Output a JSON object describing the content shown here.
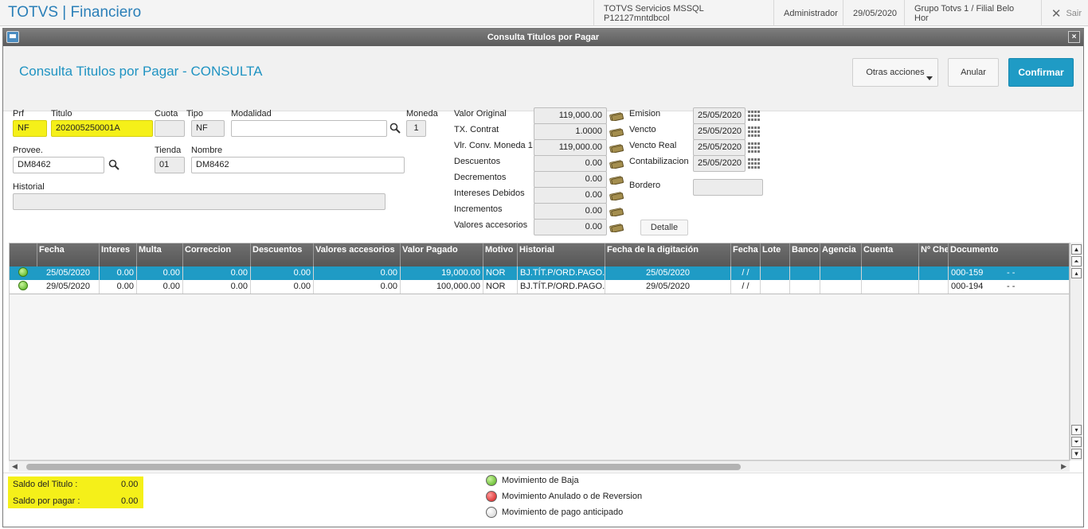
{
  "app": {
    "title": "TOTVS | Financiero",
    "environment": "TOTVS Servicios MSSQL P12127mntdbcol",
    "user": "Administrador",
    "date": "29/05/2020",
    "branch": "Grupo Totvs 1 / Filial Belo Hor",
    "exit_label": "Sair"
  },
  "window": {
    "title": "Consulta Titulos por Pagar",
    "close_label": "×"
  },
  "header": {
    "heading": "Consulta Titulos por Pagar - CONSULTA",
    "other_actions": "Otras acciones",
    "cancel": "Anular",
    "confirm": "Confirmar"
  },
  "form": {
    "prf_label": "Prf",
    "prf": "NF",
    "titulo_label": "Titulo",
    "titulo": "202005250001A",
    "cuota_label": "Cuota",
    "cuota": "",
    "tipo_label": "Tipo",
    "tipo": "NF",
    "modalidad_label": "Modalidad",
    "modalidad": "",
    "moneda_label": "Moneda",
    "moneda": "1",
    "proveedor_label": "Provee.",
    "proveedor": "DM8462",
    "tienda_label": "Tienda",
    "tienda": "01",
    "nombre_label": "Nombre",
    "nombre": "DM8462",
    "historial_label": "Historial",
    "historial": ""
  },
  "values": [
    {
      "label": "Valor Original",
      "value": "119,000.00"
    },
    {
      "label": "TX. Contrat",
      "value": "1.0000"
    },
    {
      "label": "Vlr. Conv. Moneda 1",
      "value": "119,000.00"
    },
    {
      "label": "Descuentos",
      "value": "0.00"
    },
    {
      "label": "Decrementos",
      "value": "0.00"
    },
    {
      "label": "Intereses Debidos",
      "value": "0.00"
    },
    {
      "label": "Incrementos",
      "value": "0.00"
    },
    {
      "label": "Valores accesorios",
      "value": "0.00"
    }
  ],
  "dates": [
    {
      "label": "Emision",
      "value": "25/05/2020"
    },
    {
      "label": "Vencto",
      "value": "25/05/2020"
    },
    {
      "label": "Vencto Real",
      "value": "25/05/2020"
    },
    {
      "label": "Contabilizacion",
      "value": "25/05/2020"
    }
  ],
  "bordero_label": "Bordero",
  "bordero": "",
  "detail_button": "Detalle",
  "table": {
    "columns": [
      "Fecha",
      "Interes",
      "Multa",
      "Correccion",
      "Descuentos",
      "Valores accesorios",
      "Valor Pagado",
      "Motivo",
      "Historial",
      "Fecha de la digitación",
      "Fecha",
      "Lote",
      "Banco",
      "Agencia",
      "Cuenta",
      "Nº Che",
      "Documento"
    ],
    "rows": [
      {
        "fecha": "25/05/2020",
        "interes": "0.00",
        "multa": "0.00",
        "correccion": "0.00",
        "descuentos": "0.00",
        "accesorios": "0.00",
        "pagado": "19,000.00",
        "motivo": "NOR",
        "historial": "BJ.TÍT.P/ORD.PAGO.",
        "digitacion": "25/05/2020",
        "fecha2": "/ /",
        "lote": "",
        "banco": "",
        "agencia": "",
        "cuenta": "",
        "cheque": "",
        "documento": "000-159",
        "extra": "- -"
      },
      {
        "fecha": "29/05/2020",
        "interes": "0.00",
        "multa": "0.00",
        "correccion": "0.00",
        "descuentos": "0.00",
        "accesorios": "0.00",
        "pagado": "100,000.00",
        "motivo": "NOR",
        "historial": "BJ.TÍT.P/ORD.PAGO.",
        "digitacion": "29/05/2020",
        "fecha2": "/ /",
        "lote": "",
        "banco": "",
        "agencia": "",
        "cuenta": "",
        "cheque": "",
        "documento": "000-194",
        "extra": "- -"
      }
    ]
  },
  "totals": {
    "saldo_titulo_label": "Saldo del Titulo :",
    "saldo_titulo": "0.00",
    "saldo_pagar_label": "Saldo por pagar  :",
    "saldo_pagar": "0.00"
  },
  "legend": [
    {
      "label": "Movimiento de Baja",
      "color": "#5cc21e"
    },
    {
      "label": "Movimiento Anulado o de Reversion",
      "color": "#e32020"
    },
    {
      "label": "Movimiento de pago anticipado",
      "color": "#e6e6e6"
    }
  ]
}
